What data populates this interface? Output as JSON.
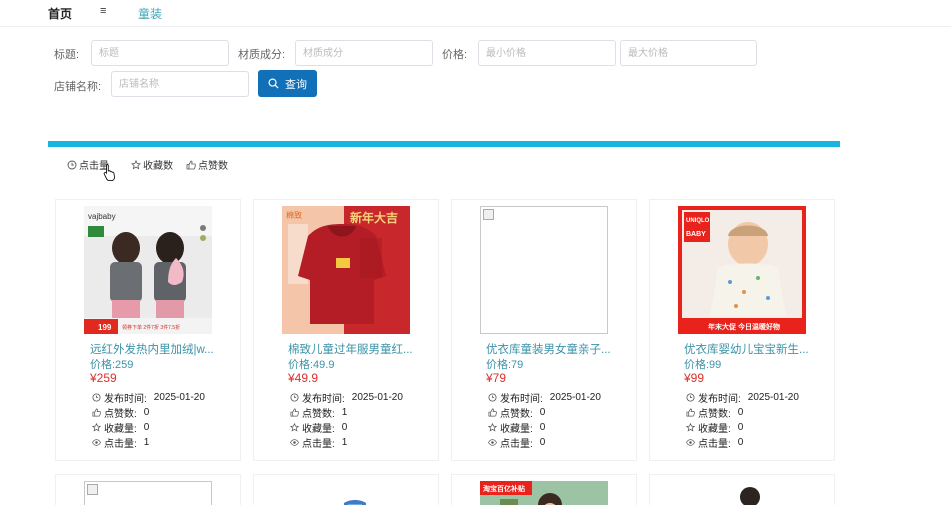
{
  "topbar": {
    "home": "首页",
    "menu_icon": "≡",
    "breadcrumb": "童装"
  },
  "filters": {
    "title_label": "标题:",
    "title_placeholder": "标题",
    "material_label": "材质成分:",
    "material_placeholder": "材质成分",
    "price_label": "价格:",
    "min_price_placeholder": "最小价格",
    "max_price_placeholder": "最大价格",
    "shop_label": "店铺名称:",
    "shop_placeholder": "店铺名称",
    "search_label": "查询"
  },
  "sort": {
    "clicks": "点击量",
    "favorites": "收藏数",
    "likes": "点赞数"
  },
  "meta_labels": {
    "publish": "发布时间:",
    "likes": "点赞数:",
    "favorites": "收藏量:",
    "clicks": "点击量:"
  },
  "products": [
    {
      "title": "远红外发热内里加绒|w...",
      "price_label": "价格:259",
      "price": "¥259",
      "date": "2025-01-20",
      "likes": "0",
      "favorites": "0",
      "clicks": "1",
      "image_text": {
        "brand": "vajbaby",
        "badge": "199",
        "promo": "领券下单 2件7折 3件7.5折"
      }
    },
    {
      "title": "棉致儿童过年服男童红...",
      "price_label": "价格:49.9",
      "price": "¥49.9",
      "date": "2025-01-20",
      "likes": "1",
      "favorites": "0",
      "clicks": "1",
      "image_text": {
        "brand": "棉致",
        "banner": "新年大吉"
      }
    },
    {
      "title": "优衣库童装男女童亲子...",
      "price_label": "价格:79",
      "price": "¥79",
      "date": "2025-01-20",
      "likes": "0",
      "favorites": "0",
      "clicks": "0",
      "image_text": {}
    },
    {
      "title": "优衣库婴幼儿宝宝新生...",
      "price_label": "价格:99",
      "price": "¥99",
      "date": "2025-01-20",
      "likes": "0",
      "favorites": "0",
      "clicks": "0",
      "image_text": {
        "brand": "UNIQLO",
        "sub": "BABY",
        "promo": "年末大促 今日温暖好物"
      }
    }
  ],
  "second_row": [
    {
      "image_text": {}
    },
    {
      "image_text": {}
    },
    {
      "image_text": {
        "banner": "淘宝百亿补贴"
      }
    },
    {
      "image_text": {}
    }
  ]
}
